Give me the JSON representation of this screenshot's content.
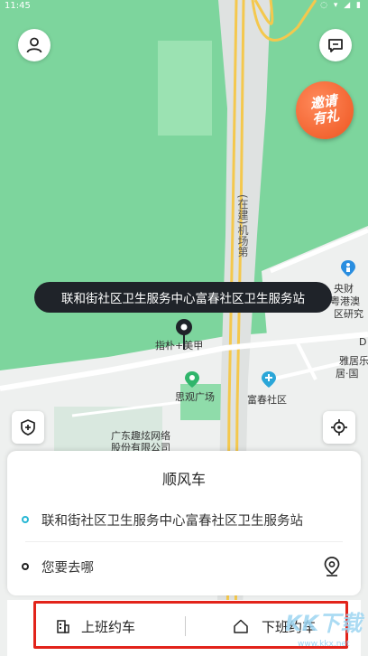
{
  "status": {
    "time": "11:45",
    "icons": "◌ ▾ ◢ ▮"
  },
  "invite": {
    "line1": "邀请",
    "line2": "有礼"
  },
  "tooltip": {
    "text": "联和街社区卫生服务中心富春社区卫生服务站"
  },
  "map": {
    "pin_label": "指朴+美甲",
    "road_label": "(在建)机场第",
    "poi_1": "思观广场",
    "poi_2": "富春社区",
    "poi_3": "广东趣炫网络",
    "poi_4": "股份有限公司",
    "poi_5": "雅居乐",
    "poi_6": "居·国",
    "poi_7": "央财",
    "poi_8": "粤港澳",
    "poi_9": "区研究",
    "poi_10": "D"
  },
  "card": {
    "title": "顺风车",
    "origin": "联和街社区卫生服务中心富春社区卫生服务站",
    "destination_placeholder": "您要去哪",
    "origin_dot_color": "#27b7d4",
    "dest_dot_color": "#222222"
  },
  "bottom": {
    "to_work": "上班约车",
    "off_work": "下班约车"
  },
  "watermark": {
    "main": "KK下载",
    "sub": "www.kkx.net"
  }
}
